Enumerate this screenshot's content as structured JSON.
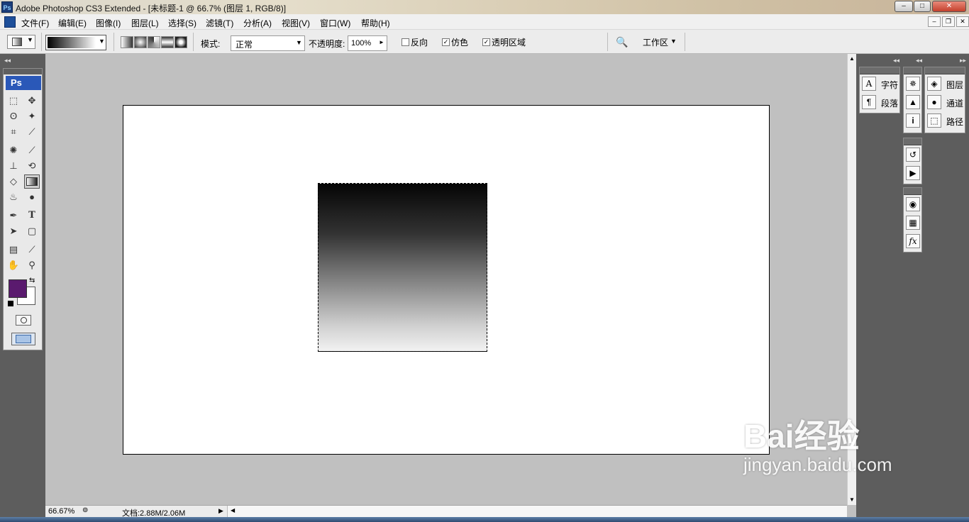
{
  "window": {
    "title": "Adobe Photoshop CS3 Extended - [未标题-1 @ 66.7% (图层 1, RGB/8)]",
    "app_icon": "Ps"
  },
  "menu": [
    "文件(F)",
    "编辑(E)",
    "图像(I)",
    "图层(L)",
    "选择(S)",
    "滤镜(T)",
    "分析(A)",
    "视图(V)",
    "窗口(W)",
    "帮助(H)"
  ],
  "options": {
    "mode_label": "模式:",
    "mode_value": "正常",
    "opacity_label": "不透明度:",
    "opacity_value": "100%",
    "reverse_label": "反向",
    "dither_label": "仿色",
    "transparency_label": "透明区域",
    "reverse_checked": false,
    "dither_checked": true,
    "transparency_checked": true,
    "workspace_label": "工作区"
  },
  "toolbox": {
    "logo": "Ps",
    "foreground_color": "#5a1a6e",
    "background_color": "#ffffff"
  },
  "panels": {
    "char": {
      "char_label": "字符",
      "para_label": "段落"
    },
    "layers": {
      "layers_label": "图层",
      "channels_label": "通道",
      "paths_label": "路径"
    }
  },
  "status": {
    "zoom": "66.67%",
    "doc_info": "文档:2.88M/2.06M"
  },
  "watermark": {
    "brand": "Bai经验",
    "url": "jingyan.baidu.com"
  }
}
